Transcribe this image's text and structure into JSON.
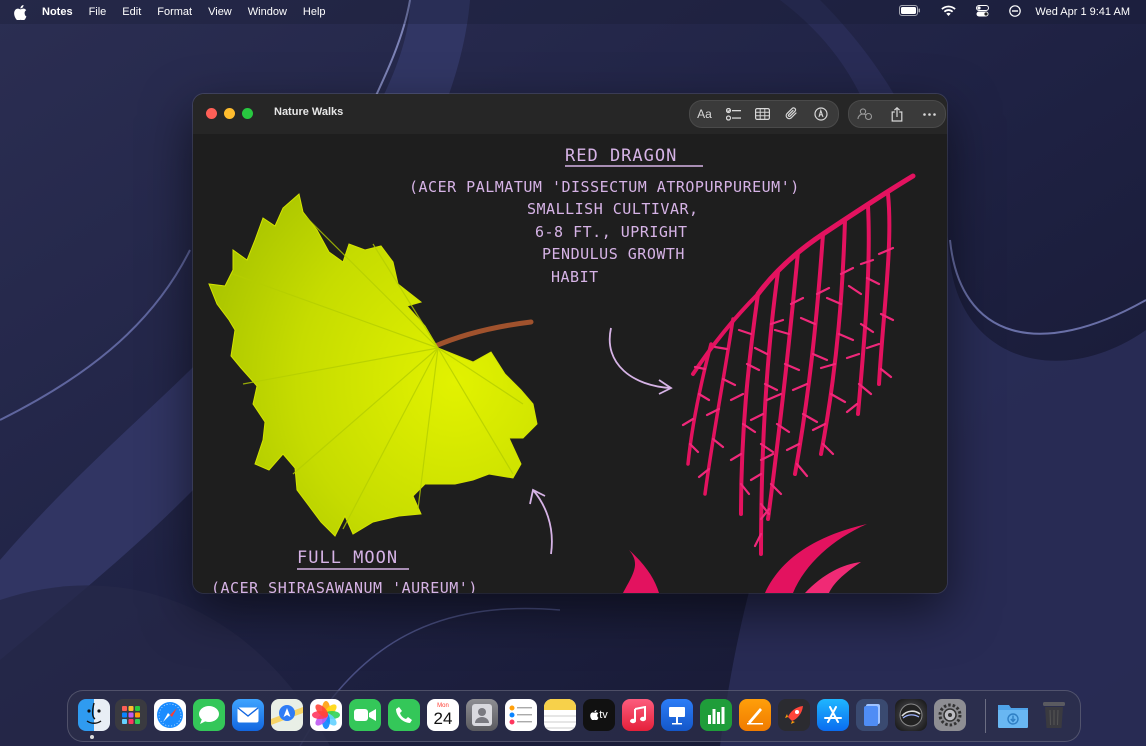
{
  "menubar": {
    "apple_icon": "apple-logo-icon",
    "app_name": "Notes",
    "menus": [
      "File",
      "Edit",
      "Format",
      "View",
      "Window",
      "Help"
    ],
    "status_icons": [
      "battery-icon",
      "wifi-icon",
      "control-center-icon",
      "focus-icon"
    ],
    "clock": "Wed Apr 1  9:41 AM"
  },
  "window": {
    "title": "Nature Walks",
    "toolbar": {
      "format_label": "Aa",
      "format_icon": "text-format-icon",
      "checklist_icon": "checklist-icon",
      "table_icon": "table-icon",
      "attachment_icon": "paperclip-icon",
      "markup_icon": "markup-pen-icon",
      "collaborate_icon": "collaborate-icon",
      "share_icon": "share-icon",
      "more_icon": "more-ellipsis-icon"
    }
  },
  "note": {
    "red_dragon": {
      "title": "RED DRAGON",
      "lines": [
        "(ACER PALMATUM 'DISSECTUM ATROPURPUREUM')",
        "SMALLISH CULTIVAR,",
        "6-8 FT., UPRIGHT",
        "PENDULUS GROWTH",
        "HABIT"
      ]
    },
    "full_moon": {
      "title": "FULL MOON",
      "lines": [
        "(ACER SHIRASAWANUM 'AUREUM')"
      ]
    },
    "accent_color": "#d6b3e6",
    "leaf_colors": {
      "yellow": "#c8e000",
      "red": "#e3125f"
    }
  },
  "dock": {
    "calendar": {
      "month": "Mon",
      "day": "24"
    },
    "tv_label": "tv",
    "apps": [
      "finder-icon",
      "launchpad-icon",
      "safari-icon",
      "messages-icon",
      "mail-icon",
      "maps-icon",
      "photos-icon",
      "facetime-icon",
      "phone-icon",
      "calendar-icon",
      "contacts-icon",
      "reminders-icon",
      "notes-icon",
      "tv-icon",
      "music-icon",
      "keynote-icon",
      "numbers-icon",
      "pages-icon",
      "rocket-icon",
      "app-store-icon",
      "preview-icon",
      "siri-icon",
      "system-settings-icon",
      "downloads-folder-icon",
      "trash-icon"
    ]
  }
}
